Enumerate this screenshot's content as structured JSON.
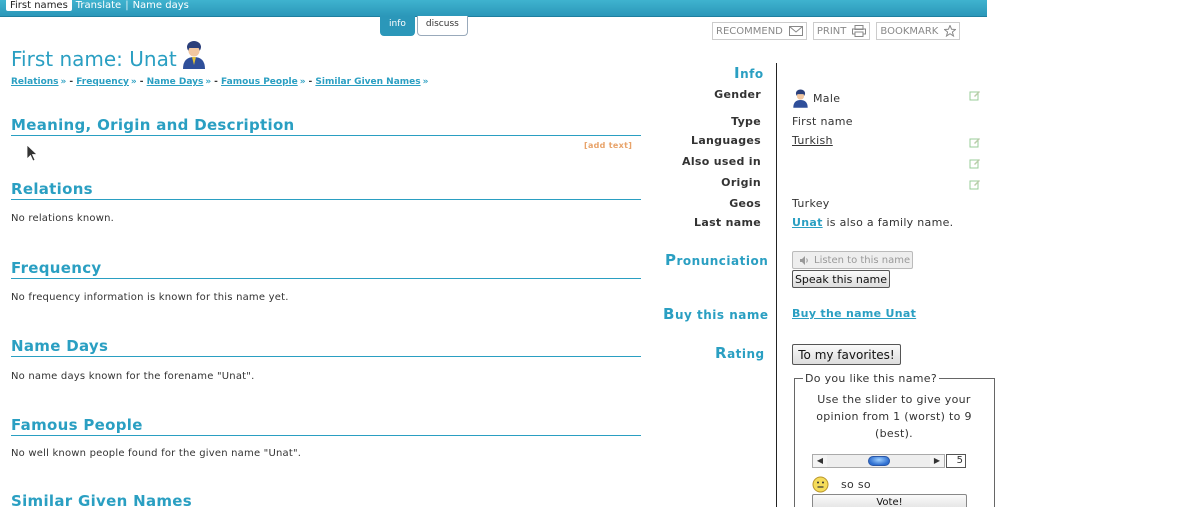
{
  "nav": {
    "items": [
      "First names",
      "Translate",
      "Name days"
    ]
  },
  "tabs": [
    "info",
    "discuss"
  ],
  "tools": {
    "recommend": "RECOMMEND",
    "print": "PRINT",
    "bookmark": "BOOKMARK"
  },
  "page": {
    "title": "First name: Unat",
    "sublinks": [
      "Relations",
      "Frequency",
      "Name Days",
      "Famous People",
      "Similar Given Names"
    ]
  },
  "sections": {
    "meaning": {
      "heading": "Meaning, Origin and Description",
      "add_text": "[add text]"
    },
    "relations": {
      "heading": "Relations",
      "text": "No relations known."
    },
    "frequency": {
      "heading": "Frequency",
      "text": "No frequency information is known for this name yet."
    },
    "namedays": {
      "heading": "Name Days",
      "text": "No name days known for the forename \"Unat\"."
    },
    "famous": {
      "heading": "Famous People",
      "text": "No well known people found for the given name \"Unat\"."
    },
    "similar": {
      "heading": "Similar Given Names"
    }
  },
  "info": {
    "heading_cap": "I",
    "heading_rest": "nfo",
    "gender_label": "Gender",
    "gender_value": "Male",
    "type_label": "Type",
    "type_value": "First name",
    "languages_label": "Languages",
    "languages_value": "Turkish",
    "also_label": "Also used in",
    "origin_label": "Origin",
    "geos_label": "Geos",
    "geos_value": "Turkey",
    "lastname_label": "Last name",
    "lastname_link": "Unat",
    "lastname_rest": " is also a family name."
  },
  "pronunciation": {
    "heading_cap": "P",
    "heading_rest": "ronunciation",
    "listen_label": "Listen to this name",
    "speak_label": "Speak this name"
  },
  "buy": {
    "heading_cap": "B",
    "heading_rest": "uy this name",
    "link": "Buy the name Unat"
  },
  "rating": {
    "heading_cap": "R",
    "heading_rest": "ating",
    "favorites_label": "To my favorites!",
    "legend": "Do you like this name?",
    "instructions": "Use the slider to give your opinion from 1 (worst) to 9 (best).",
    "slider_value": "5",
    "slider_fraction": 0.5,
    "mood_label": "so so",
    "vote_label": "Vote!"
  },
  "colors": {
    "accent": "#2a9fc2",
    "topbar": "#2b97b9",
    "addtext": "#e8a36a"
  },
  "icons": [
    "envelope-icon",
    "printer-icon",
    "star-icon",
    "user-avatar-icon",
    "edit-icon",
    "speaker-icon",
    "smiley-icon",
    "cursor-icon"
  ]
}
